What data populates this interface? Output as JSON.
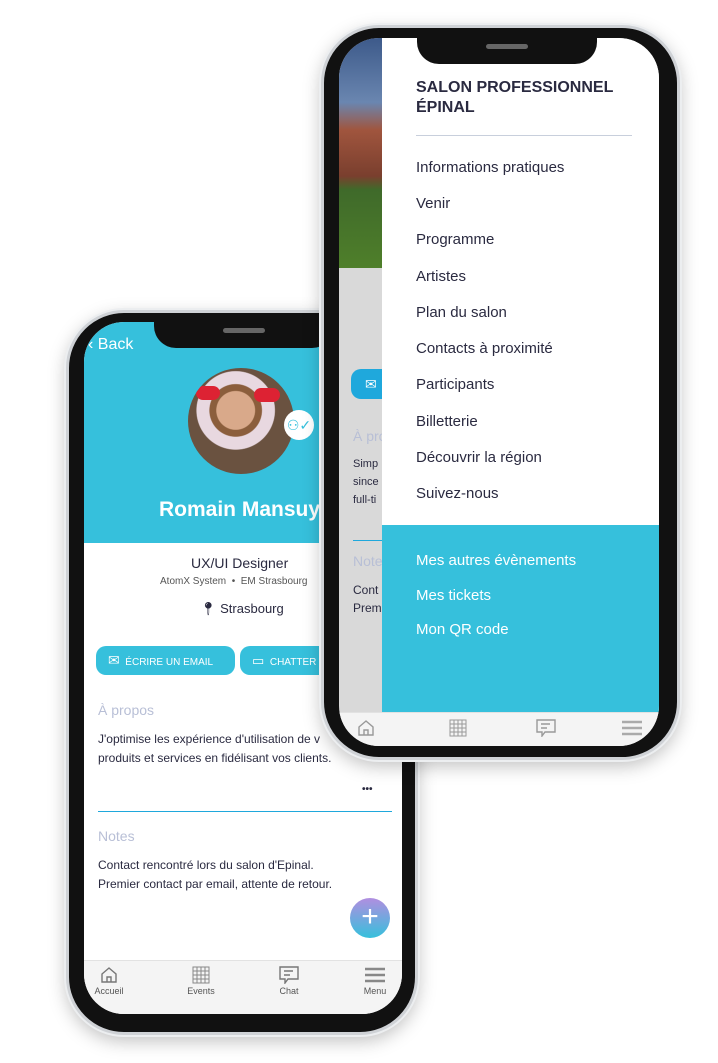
{
  "profile_phone": {
    "back_label": "Back",
    "name": "Romain Mansuy",
    "job_title": "UX/UI Designer",
    "company": "AtomX System",
    "school": "EM Strasbourg",
    "location": "Strasbourg",
    "email_button": "ÉCRIRE UN EMAIL",
    "chat_button": "CHATTER",
    "about_heading": "À propos",
    "about_text_1": "J'optimise les expérience d'utilisation de v",
    "about_text_2": "produits et services en fidélisant vos clients.",
    "more_label": "•••",
    "notes_heading": "Notes",
    "notes_text_1": "Contact rencontré lors du salon d'Epinal.",
    "notes_text_2": "Premier contact par email, attente de retour.",
    "fab_label": "+",
    "tabs": [
      {
        "label": "Accueil",
        "icon": "home-icon"
      },
      {
        "label": "Events",
        "icon": "grid-icon"
      },
      {
        "label": "Chat",
        "icon": "chat-icon"
      },
      {
        "label": "Menu",
        "icon": "menu-icon"
      }
    ]
  },
  "menu_phone": {
    "background_fragments": {
      "about": "À pro",
      "line1": "Simp",
      "line2": "since",
      "line3": "full-ti",
      "notes": "Note",
      "notes1": "Cont",
      "notes2": "Prem"
    },
    "title_line1": "SALON PROFESSIONNEL",
    "title_line2": "ÉPINAL",
    "items": [
      "Informations pratiques",
      "Venir",
      "Programme",
      "Artistes",
      "Plan du salon",
      "Contacts à proximité",
      "Participants",
      "Billetterie",
      "Découvrir la région",
      "Suivez-nous"
    ],
    "secondary_items": [
      "Mes autres évènements",
      "Mes tickets",
      "Mon QR code"
    ]
  },
  "colors": {
    "accent": "#36c0dc",
    "text": "#2a2a40",
    "muted": "#b8bfd6"
  }
}
